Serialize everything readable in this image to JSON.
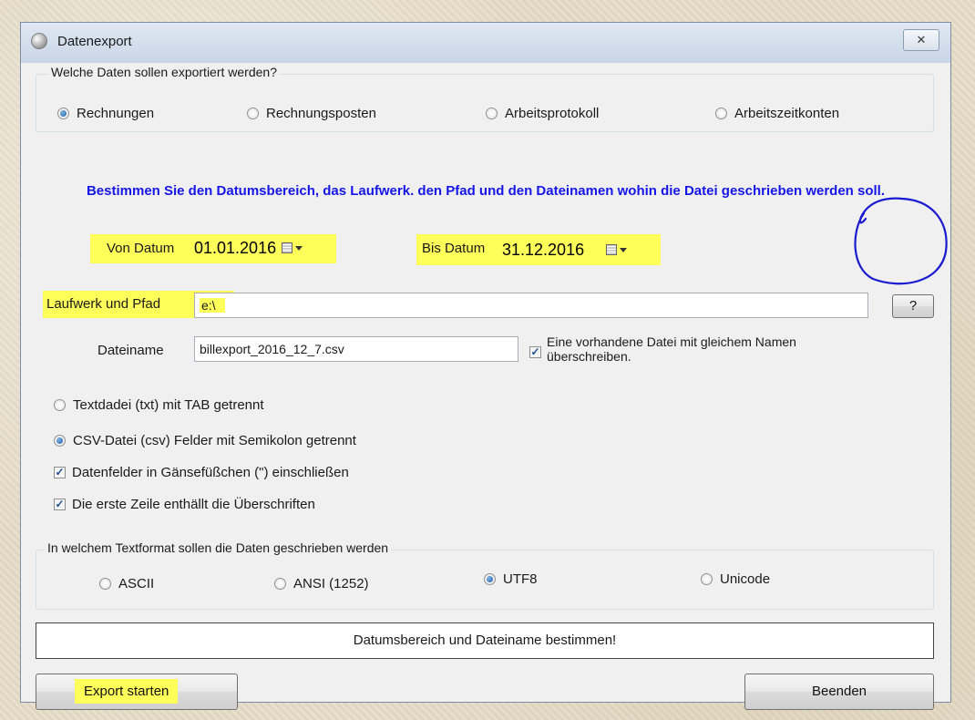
{
  "window": {
    "title": "Datenexport",
    "close_label": "✕"
  },
  "data_group": {
    "legend": "Welche Daten sollen exportiert werden?",
    "options": [
      "Rechnungen",
      "Rechnungsposten",
      "Arbeitsprotokoll",
      "Arbeitszeitkonten"
    ],
    "selected": "Rechnungen"
  },
  "instruction": "Bestimmen Sie den Datumsbereich, das Laufwerk. den Pfad und den Dateinamen wohin die Datei geschrieben werden soll.",
  "date_from": {
    "label": "Von Datum",
    "value": "01.01.2016"
  },
  "date_to": {
    "label": "Bis Datum",
    "value": "31.12.2016"
  },
  "path": {
    "label": "Laufwerk und Pfad",
    "value": "e:\\",
    "browse_label": "?"
  },
  "filename": {
    "label": "Dateiname",
    "value": "billexport_2016_12_7.csv"
  },
  "overwrite": {
    "label_line1": "Eine vorhandene Datei mit gleichem Namen",
    "label_line2": "überschreiben.",
    "checked": true
  },
  "format": {
    "txt_label": "Textdadei (txt) mit TAB getrennt",
    "csv_label": "CSV-Datei (csv) Felder mit Semikolon getrennt",
    "selected": "csv",
    "quote_label": "Datenfelder in Gänsefüßchen (\") einschließen",
    "quote_checked": true,
    "header_label": "Die erste Zeile enthällt die Überschriften",
    "header_checked": true
  },
  "encoding_group": {
    "legend": "In welchem Textformat sollen die Daten geschrieben werden",
    "options": [
      "ASCII",
      "ANSI (1252)",
      "UTF8",
      "Unicode"
    ],
    "selected": "UTF8"
  },
  "status": "Datumsbereich und Dateiname bestimmen!",
  "buttons": {
    "export": "Export starten",
    "quit": "Beenden"
  },
  "colors": {
    "instruction": "#1515e8",
    "highlight": "#ffff5a",
    "annotation": "#1a1ad0"
  },
  "icons": {
    "window": "app-globe-icon",
    "calendar": "calendar-icon",
    "dropdown": "chevron-down-icon"
  }
}
